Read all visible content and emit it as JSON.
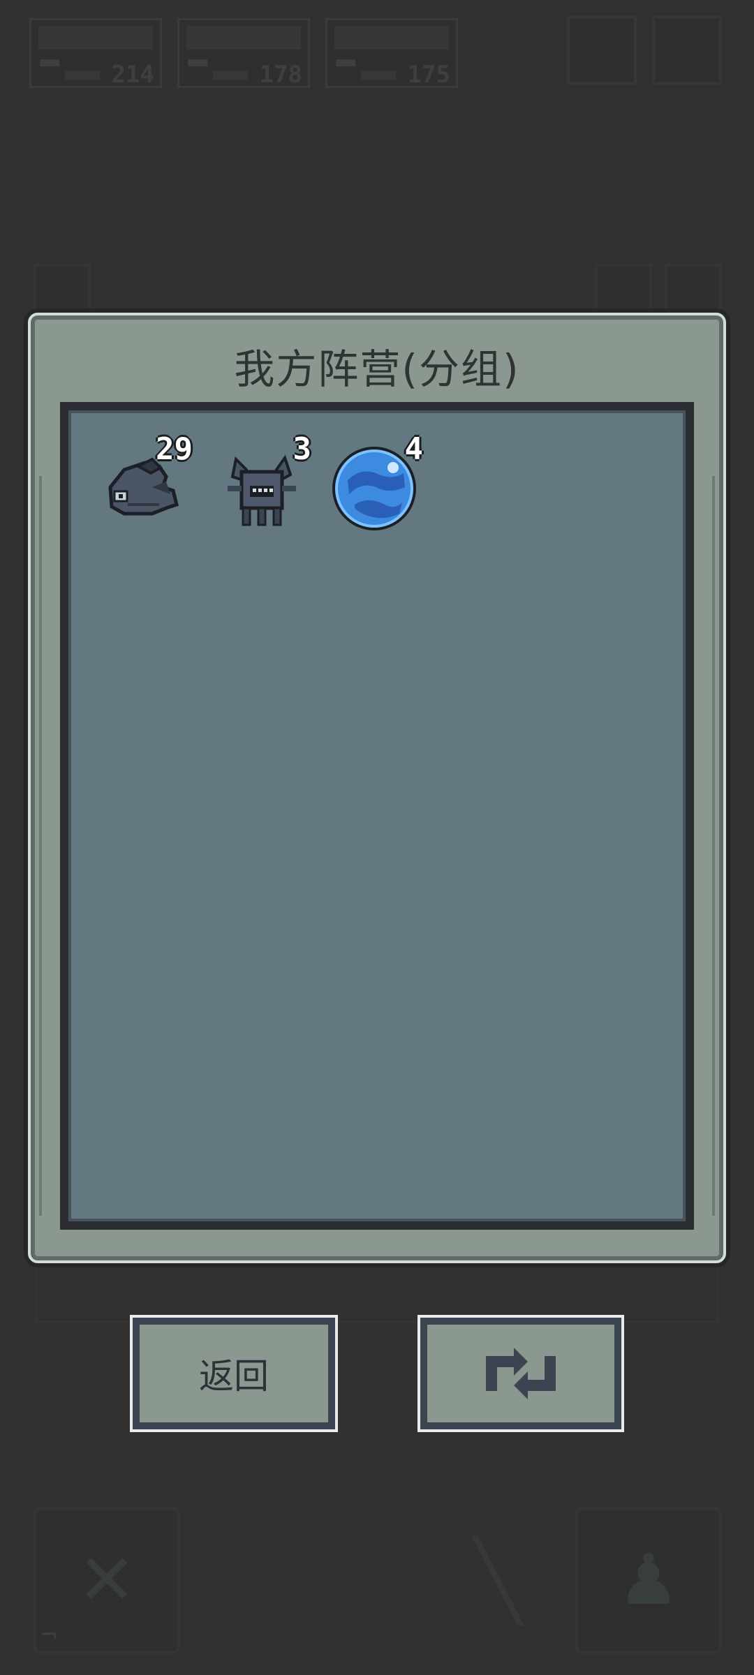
{
  "hud": {
    "stats": [
      {
        "value": "214"
      },
      {
        "value": "178"
      },
      {
        "value": "175"
      }
    ]
  },
  "panel": {
    "title": "我方阵营(分组)"
  },
  "units": [
    {
      "name": "shark-creature",
      "count": "29"
    },
    {
      "name": "crab-creature",
      "count": "3"
    },
    {
      "name": "blue-orb",
      "count": "4"
    }
  ],
  "buttons": {
    "back_label": "返回",
    "swap_icon": "swap-icon"
  },
  "colors": {
    "panel_bg": "#8a9890",
    "inner_bg": "#637880",
    "frame_dark": "#2b2d33",
    "orb_blue": "#3d8be0"
  }
}
